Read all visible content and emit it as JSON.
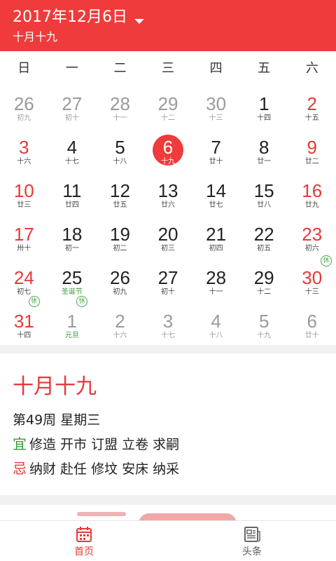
{
  "header": {
    "date": "2017年12月6日",
    "lunar": "十月十九"
  },
  "weekdays": [
    "日",
    "一",
    "二",
    "三",
    "四",
    "五",
    "六"
  ],
  "calendar": {
    "rows": [
      [
        {
          "day": "26",
          "lunar": "初九",
          "state": "other"
        },
        {
          "day": "27",
          "lunar": "初十",
          "state": "other"
        },
        {
          "day": "28",
          "lunar": "十一",
          "state": "other"
        },
        {
          "day": "29",
          "lunar": "十二",
          "state": "other"
        },
        {
          "day": "30",
          "lunar": "十三",
          "state": "other"
        },
        {
          "day": "1",
          "lunar": "十四",
          "state": "normal"
        },
        {
          "day": "2",
          "lunar": "十五",
          "state": "weekend"
        }
      ],
      [
        {
          "day": "3",
          "lunar": "十六",
          "state": "weekend"
        },
        {
          "day": "4",
          "lunar": "十七",
          "state": "normal"
        },
        {
          "day": "5",
          "lunar": "十八",
          "state": "normal"
        },
        {
          "day": "6",
          "lunar": "十九",
          "state": "today"
        },
        {
          "day": "7",
          "lunar": "廿十",
          "state": "normal"
        },
        {
          "day": "8",
          "lunar": "廿一",
          "state": "normal"
        },
        {
          "day": "9",
          "lunar": "廿二",
          "state": "weekend"
        }
      ],
      [
        {
          "day": "10",
          "lunar": "廿三",
          "state": "weekend"
        },
        {
          "day": "11",
          "lunar": "廿四",
          "state": "normal"
        },
        {
          "day": "12",
          "lunar": "廿五",
          "state": "normal"
        },
        {
          "day": "13",
          "lunar": "廿六",
          "state": "normal"
        },
        {
          "day": "14",
          "lunar": "廿七",
          "state": "normal"
        },
        {
          "day": "15",
          "lunar": "廿八",
          "state": "normal"
        },
        {
          "day": "16",
          "lunar": "廿九",
          "state": "weekend"
        }
      ],
      [
        {
          "day": "17",
          "lunar": "卅十",
          "state": "weekend"
        },
        {
          "day": "18",
          "lunar": "初一",
          "state": "normal"
        },
        {
          "day": "19",
          "lunar": "初二",
          "state": "normal"
        },
        {
          "day": "20",
          "lunar": "初三",
          "state": "normal"
        },
        {
          "day": "21",
          "lunar": "初四",
          "state": "normal"
        },
        {
          "day": "22",
          "lunar": "初五",
          "state": "normal"
        },
        {
          "day": "23",
          "lunar": "初六",
          "state": "weekend"
        }
      ],
      [
        {
          "day": "24",
          "lunar": "初七",
          "state": "weekend"
        },
        {
          "day": "25",
          "lunar": "圣诞节",
          "state": "festival"
        },
        {
          "day": "26",
          "lunar": "初九",
          "state": "normal"
        },
        {
          "day": "27",
          "lunar": "初十",
          "state": "normal"
        },
        {
          "day": "28",
          "lunar": "十一",
          "state": "normal"
        },
        {
          "day": "29",
          "lunar": "十二",
          "state": "normal"
        },
        {
          "day": "30",
          "lunar": "十三",
          "state": "weekend",
          "badge": "休"
        }
      ],
      [
        {
          "day": "31",
          "lunar": "十四",
          "state": "weekend",
          "badge": "休"
        },
        {
          "day": "1",
          "lunar": "元旦",
          "state": "other-festival",
          "badge": "休"
        },
        {
          "day": "2",
          "lunar": "十六",
          "state": "other"
        },
        {
          "day": "3",
          "lunar": "十七",
          "state": "other"
        },
        {
          "day": "4",
          "lunar": "十八",
          "state": "other"
        },
        {
          "day": "5",
          "lunar": "十九",
          "state": "other"
        },
        {
          "day": "6",
          "lunar": "廿十",
          "state": "other"
        }
      ]
    ]
  },
  "detail": {
    "lunar": "十月十九",
    "week": "第49周 星期三",
    "yi_tag": "宜",
    "yi": "修造 开市 订盟 立卷 求嗣",
    "ji_tag": "忌",
    "ji": "纳财 赴任 修坟 安床 纳采"
  },
  "tabs": [
    {
      "label": "首页",
      "icon": "calendar-icon",
      "active": true
    },
    {
      "label": "头条",
      "icon": "news-icon",
      "active": false
    }
  ],
  "colors": {
    "accent": "#ef3b3b",
    "festival": "#3a9a3a",
    "muted": "#9a9a9a"
  }
}
